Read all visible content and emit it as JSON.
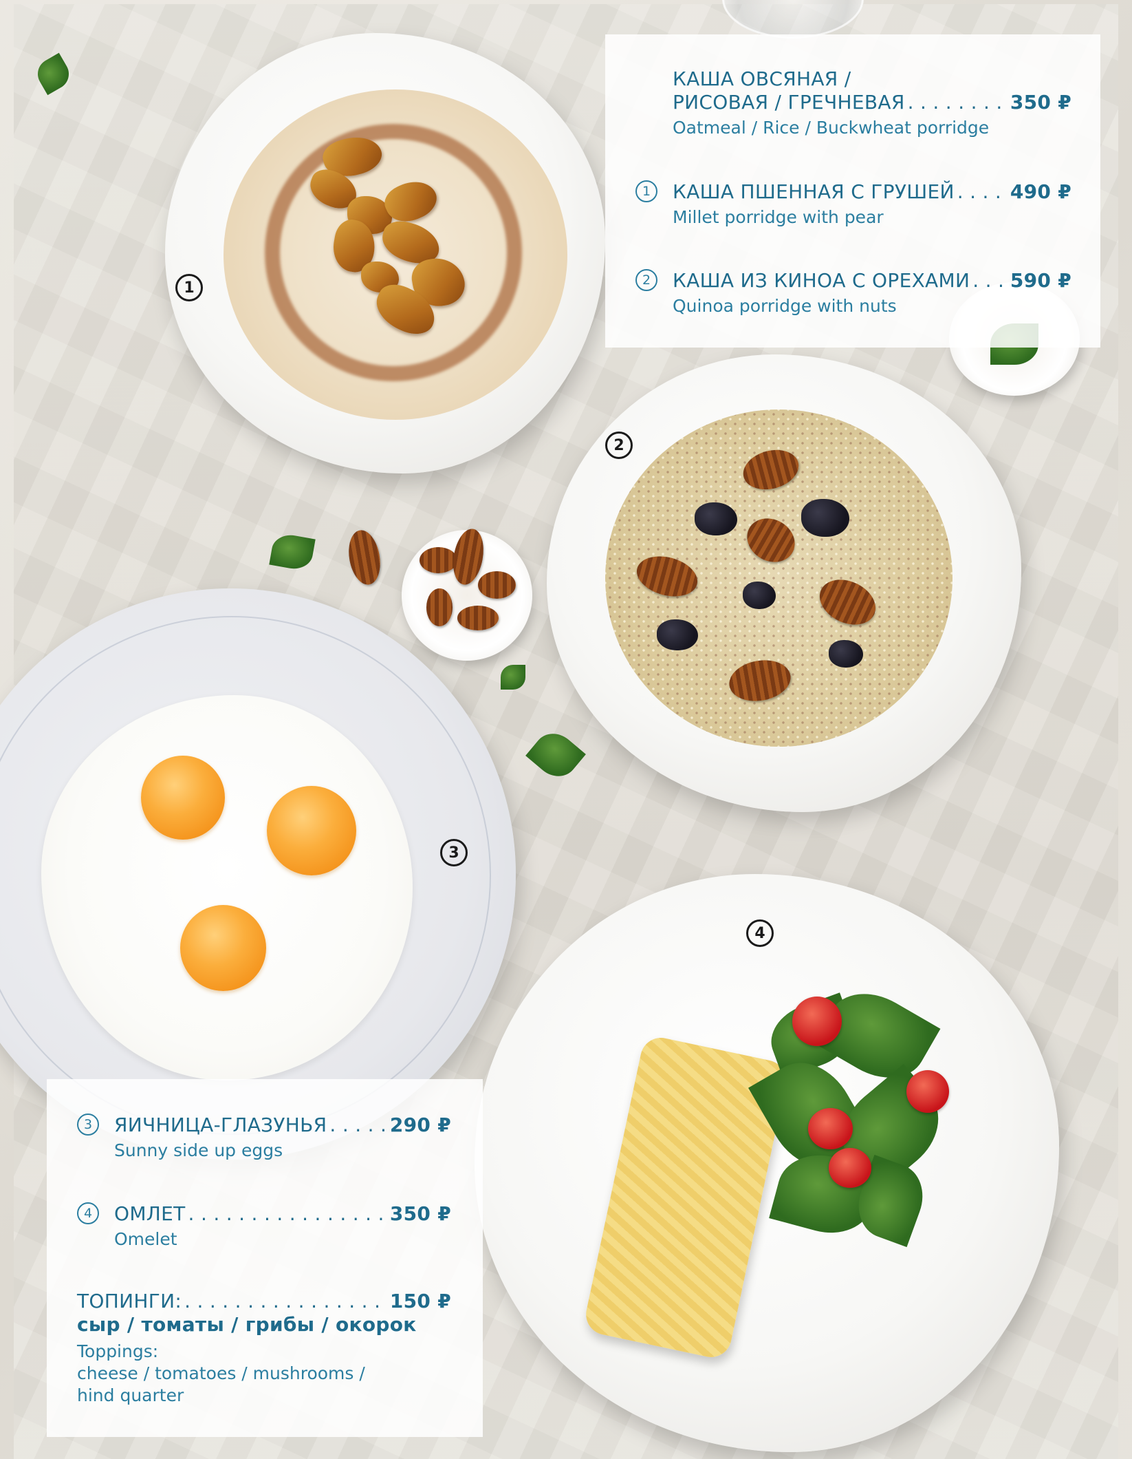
{
  "colors": {
    "menu_text": "#1f6b8c",
    "badge": "#1a1a1a"
  },
  "photo_badges": [
    "1",
    "2",
    "3",
    "4"
  ],
  "top_menu": {
    "items": [
      {
        "number": "",
        "name_line1": "КАША ОВСЯНАЯ /",
        "name_line2": "РИСОВАЯ / ГРЕЧНЕВАЯ",
        "price": "350 ₽",
        "english": "Oatmeal / Rice / Buckwheat porridge"
      },
      {
        "number": "1",
        "name": "КАША ПШЕННАЯ С ГРУШЕЙ",
        "price": "490 ₽",
        "english": "Millet porridge with pear"
      },
      {
        "number": "2",
        "name": "КАША ИЗ КИНОА С ОРЕХАМИ",
        "price": "590 ₽",
        "english": "Quinoa porridge with nuts"
      }
    ]
  },
  "bottom_menu": {
    "items": [
      {
        "number": "3",
        "name": "ЯИЧНИЦА-ГЛАЗУНЬЯ",
        "price": "290 ₽",
        "english": "Sunny side up eggs"
      },
      {
        "number": "4",
        "name": "ОМЛЕТ",
        "price": "350 ₽",
        "english": "Omelet"
      }
    ],
    "toppings": {
      "name": "ТОПИНГИ:",
      "price": "150 ₽",
      "list_ru": "сыр / томаты / грибы / окорок",
      "english_line1": "Toppings:",
      "english_line2": "cheese / tomatoes / mushrooms /",
      "english_line3": "hind quarter"
    }
  }
}
